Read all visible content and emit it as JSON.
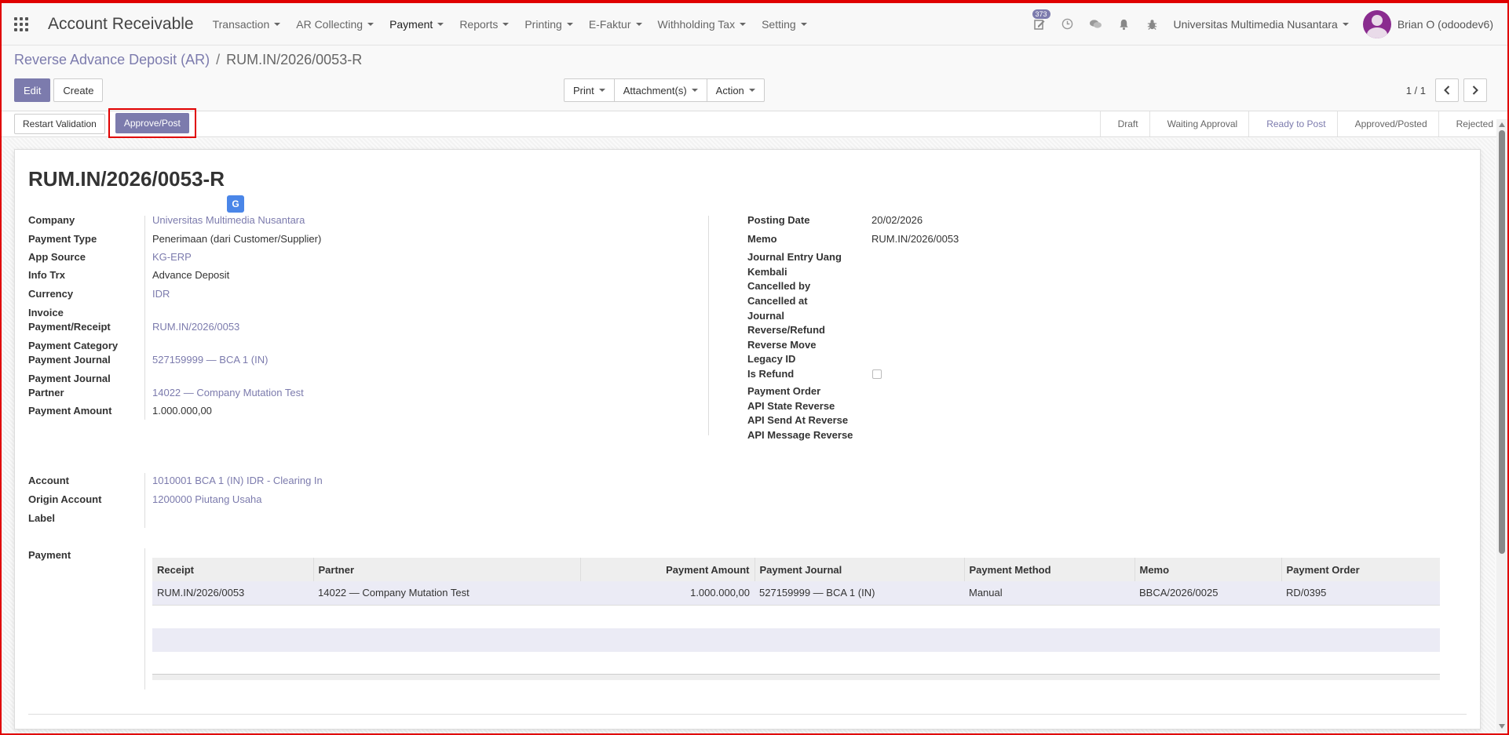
{
  "navbar": {
    "app_title": "Account Receivable",
    "menu": [
      {
        "label": "Transaction"
      },
      {
        "label": "AR Collecting"
      },
      {
        "label": "Payment"
      },
      {
        "label": "Reports"
      },
      {
        "label": "Printing"
      },
      {
        "label": "E-Faktur"
      },
      {
        "label": "Withholding Tax"
      },
      {
        "label": "Setting"
      }
    ],
    "activity_count": "373",
    "company": "Universitas Multimedia Nusantara",
    "user": "Brian O (odoodev6)"
  },
  "breadcrumb": {
    "parent": "Reverse Advance Deposit (AR)",
    "separator": "/",
    "current": "RUM.IN/2026/0053-R"
  },
  "control_panel": {
    "edit_label": "Edit",
    "create_label": "Create",
    "print_label": "Print",
    "attachments_label": "Attachment(s)",
    "action_label": "Action",
    "pager": "1 / 1"
  },
  "statusbar": {
    "restart_label": "Restart Validation",
    "approve_label": "Approve/Post",
    "stages": [
      "Draft",
      "Waiting Approval",
      "Ready to Post",
      "Approved/Posted",
      "Rejected"
    ],
    "current_stage": "Ready to Post"
  },
  "form": {
    "title": "RUM.IN/2026/0053-R",
    "translate_icon": "G",
    "left_fields": [
      {
        "label": "Company",
        "value": "Universitas Multimedia Nusantara"
      },
      {
        "label": "Payment Type",
        "value": "Penerimaan (dari Customer/Supplier)"
      },
      {
        "label": "App Source",
        "value": "KG-ERP"
      },
      {
        "label": "Info Trx",
        "value": "Advance Deposit"
      },
      {
        "label": "Currency",
        "value": "IDR"
      },
      {
        "label": "Invoice",
        "value": ""
      },
      {
        "label": "Payment/Receipt",
        "value": "RUM.IN/2026/0053"
      },
      {
        "label": "Payment Category",
        "value": ""
      },
      {
        "label": "Payment Journal",
        "value": "527159999 — BCA 1 (IN)"
      },
      {
        "label": "Payment Journal",
        "value": ""
      },
      {
        "label": "Partner",
        "value": "14022 — Company Mutation Test"
      },
      {
        "label": "Payment Amount",
        "value": "1.000.000,00"
      }
    ],
    "right_fields": [
      {
        "label": "Posting Date",
        "value": "20/02/2026"
      },
      {
        "label": "Memo",
        "value": "RUM.IN/2026/0053"
      },
      {
        "label": "Journal Entry Uang",
        "value": ""
      },
      {
        "label": "Kembali",
        "value": ""
      },
      {
        "label": "Cancelled by",
        "value": ""
      },
      {
        "label": "Cancelled at",
        "value": ""
      },
      {
        "label": "Journal",
        "value": ""
      },
      {
        "label": "Reverse/Refund",
        "value": ""
      },
      {
        "label": "Reverse Move",
        "value": ""
      },
      {
        "label": "Legacy ID",
        "value": ""
      },
      {
        "label": "Is Refund",
        "value": ""
      },
      {
        "label": "Payment Order",
        "value": ""
      },
      {
        "label": "API State Reverse",
        "value": ""
      },
      {
        "label": "API Send At Reverse",
        "value": ""
      },
      {
        "label": "API Message Reverse",
        "value": ""
      }
    ],
    "account_fields": [
      {
        "label": "Account",
        "value": "1010001 BCA 1 (IN) IDR - Clearing In"
      },
      {
        "label": "Origin Account",
        "value": "1200000 Piutang Usaha"
      },
      {
        "label": "Label",
        "value": ""
      }
    ],
    "payment_section_label": "Payment"
  },
  "payment_table": {
    "columns": [
      "Receipt",
      "Partner",
      "Payment Amount",
      "Payment Journal",
      "Payment Method",
      "Memo",
      "Payment Order"
    ],
    "rows": [
      [
        "RUM.IN/2026/0053",
        "14022 — Company Mutation Test",
        "1.000.000,00",
        "527159999 — BCA 1 (IN)",
        "Manual",
        "BBCA/2026/0025",
        "RD/0395"
      ]
    ]
  }
}
